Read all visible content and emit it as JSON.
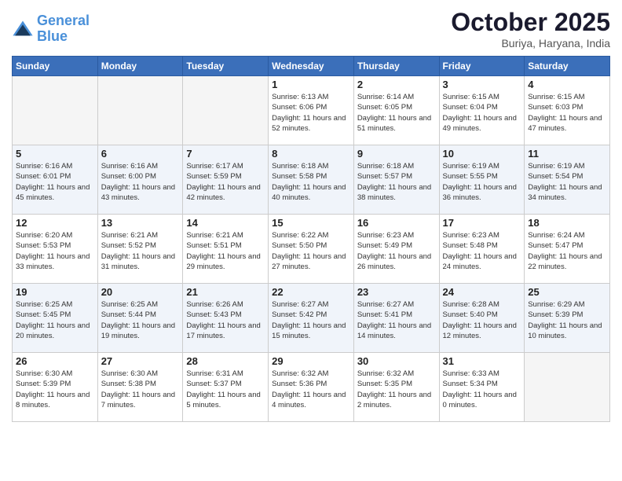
{
  "header": {
    "logo_line1": "General",
    "logo_line2": "Blue",
    "month": "October 2025",
    "location": "Buriya, Haryana, India"
  },
  "weekdays": [
    "Sunday",
    "Monday",
    "Tuesday",
    "Wednesday",
    "Thursday",
    "Friday",
    "Saturday"
  ],
  "weeks": [
    [
      {
        "day": "",
        "empty": true
      },
      {
        "day": "",
        "empty": true
      },
      {
        "day": "",
        "empty": true
      },
      {
        "day": "1",
        "sunrise": "6:13 AM",
        "sunset": "6:06 PM",
        "daylight": "11 hours and 52 minutes."
      },
      {
        "day": "2",
        "sunrise": "6:14 AM",
        "sunset": "6:05 PM",
        "daylight": "11 hours and 51 minutes."
      },
      {
        "day": "3",
        "sunrise": "6:15 AM",
        "sunset": "6:04 PM",
        "daylight": "11 hours and 49 minutes."
      },
      {
        "day": "4",
        "sunrise": "6:15 AM",
        "sunset": "6:03 PM",
        "daylight": "11 hours and 47 minutes."
      }
    ],
    [
      {
        "day": "5",
        "sunrise": "6:16 AM",
        "sunset": "6:01 PM",
        "daylight": "11 hours and 45 minutes."
      },
      {
        "day": "6",
        "sunrise": "6:16 AM",
        "sunset": "6:00 PM",
        "daylight": "11 hours and 43 minutes."
      },
      {
        "day": "7",
        "sunrise": "6:17 AM",
        "sunset": "5:59 PM",
        "daylight": "11 hours and 42 minutes."
      },
      {
        "day": "8",
        "sunrise": "6:18 AM",
        "sunset": "5:58 PM",
        "daylight": "11 hours and 40 minutes."
      },
      {
        "day": "9",
        "sunrise": "6:18 AM",
        "sunset": "5:57 PM",
        "daylight": "11 hours and 38 minutes."
      },
      {
        "day": "10",
        "sunrise": "6:19 AM",
        "sunset": "5:55 PM",
        "daylight": "11 hours and 36 minutes."
      },
      {
        "day": "11",
        "sunrise": "6:19 AM",
        "sunset": "5:54 PM",
        "daylight": "11 hours and 34 minutes."
      }
    ],
    [
      {
        "day": "12",
        "sunrise": "6:20 AM",
        "sunset": "5:53 PM",
        "daylight": "11 hours and 33 minutes."
      },
      {
        "day": "13",
        "sunrise": "6:21 AM",
        "sunset": "5:52 PM",
        "daylight": "11 hours and 31 minutes."
      },
      {
        "day": "14",
        "sunrise": "6:21 AM",
        "sunset": "5:51 PM",
        "daylight": "11 hours and 29 minutes."
      },
      {
        "day": "15",
        "sunrise": "6:22 AM",
        "sunset": "5:50 PM",
        "daylight": "11 hours and 27 minutes."
      },
      {
        "day": "16",
        "sunrise": "6:23 AM",
        "sunset": "5:49 PM",
        "daylight": "11 hours and 26 minutes."
      },
      {
        "day": "17",
        "sunrise": "6:23 AM",
        "sunset": "5:48 PM",
        "daylight": "11 hours and 24 minutes."
      },
      {
        "day": "18",
        "sunrise": "6:24 AM",
        "sunset": "5:47 PM",
        "daylight": "11 hours and 22 minutes."
      }
    ],
    [
      {
        "day": "19",
        "sunrise": "6:25 AM",
        "sunset": "5:45 PM",
        "daylight": "11 hours and 20 minutes."
      },
      {
        "day": "20",
        "sunrise": "6:25 AM",
        "sunset": "5:44 PM",
        "daylight": "11 hours and 19 minutes."
      },
      {
        "day": "21",
        "sunrise": "6:26 AM",
        "sunset": "5:43 PM",
        "daylight": "11 hours and 17 minutes."
      },
      {
        "day": "22",
        "sunrise": "6:27 AM",
        "sunset": "5:42 PM",
        "daylight": "11 hours and 15 minutes."
      },
      {
        "day": "23",
        "sunrise": "6:27 AM",
        "sunset": "5:41 PM",
        "daylight": "11 hours and 14 minutes."
      },
      {
        "day": "24",
        "sunrise": "6:28 AM",
        "sunset": "5:40 PM",
        "daylight": "11 hours and 12 minutes."
      },
      {
        "day": "25",
        "sunrise": "6:29 AM",
        "sunset": "5:39 PM",
        "daylight": "11 hours and 10 minutes."
      }
    ],
    [
      {
        "day": "26",
        "sunrise": "6:30 AM",
        "sunset": "5:39 PM",
        "daylight": "11 hours and 8 minutes."
      },
      {
        "day": "27",
        "sunrise": "6:30 AM",
        "sunset": "5:38 PM",
        "daylight": "11 hours and 7 minutes."
      },
      {
        "day": "28",
        "sunrise": "6:31 AM",
        "sunset": "5:37 PM",
        "daylight": "11 hours and 5 minutes."
      },
      {
        "day": "29",
        "sunrise": "6:32 AM",
        "sunset": "5:36 PM",
        "daylight": "11 hours and 4 minutes."
      },
      {
        "day": "30",
        "sunrise": "6:32 AM",
        "sunset": "5:35 PM",
        "daylight": "11 hours and 2 minutes."
      },
      {
        "day": "31",
        "sunrise": "6:33 AM",
        "sunset": "5:34 PM",
        "daylight": "11 hours and 0 minutes."
      },
      {
        "day": "",
        "empty": true
      }
    ]
  ]
}
